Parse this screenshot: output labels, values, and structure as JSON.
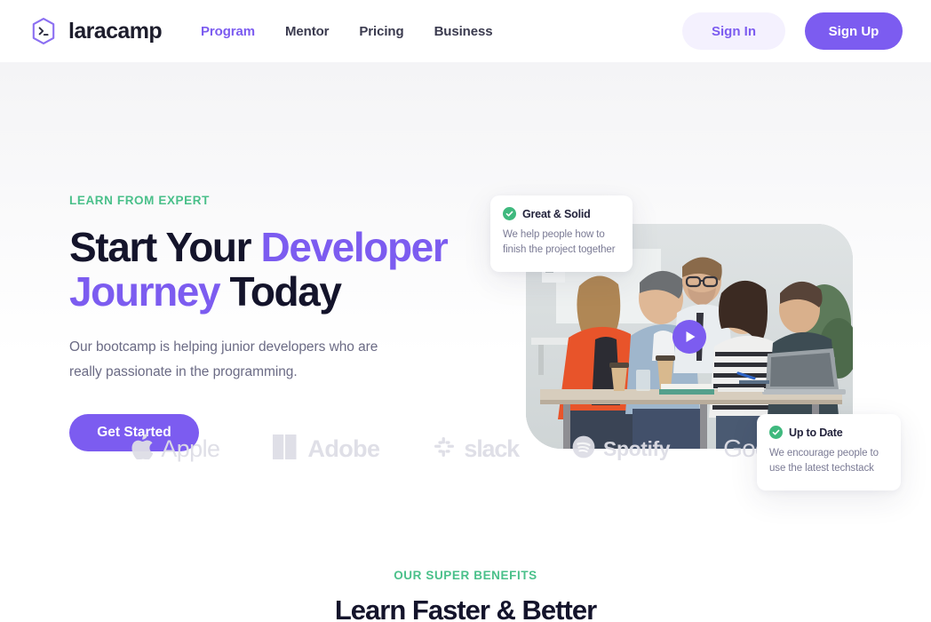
{
  "header": {
    "logo": {
      "icon": "hexagon-terminal-icon",
      "name": "laracamp"
    },
    "nav": [
      {
        "label": "Program",
        "active": true
      },
      {
        "label": "Mentor",
        "active": false
      },
      {
        "label": "Pricing",
        "active": false
      },
      {
        "label": "Business",
        "active": false
      }
    ],
    "sign_in": "Sign In",
    "sign_up": "Sign Up"
  },
  "hero": {
    "eyebrow": "LEARN FROM EXPERT",
    "title_line1_a": "Start Your ",
    "title_line1_b": "Developer",
    "title_line2_a": "Journey",
    "title_line2_b": " Today",
    "subtitle": "Our bootcamp is helping junior developers who are really passionate in the programming.",
    "cta": "Get Started",
    "play_button": "play-icon",
    "cards": [
      {
        "icon": "check-circle-icon",
        "title": "Great & Solid",
        "body": "We help people how to\nfinish the project together"
      },
      {
        "icon": "check-circle-icon",
        "title": "Up to Date",
        "body": "We encourage people to\nuse the latest techstack"
      }
    ]
  },
  "brands": [
    {
      "icon": "apple-icon",
      "label": "Apple"
    },
    {
      "icon": "adobe-icon",
      "label": "Adobe"
    },
    {
      "icon": "slack-icon",
      "label": "slack"
    },
    {
      "icon": "spotify-icon",
      "label": "Spotify"
    },
    {
      "icon": "google-icon",
      "label": "Google"
    }
  ],
  "benefits": {
    "eyebrow": "OUR SUPER BENEFITS",
    "title": "Learn Faster & Better"
  },
  "colors": {
    "accent_purple": "#7c5cf0",
    "accent_green": "#4ac08a",
    "text_dark": "#14142b",
    "text_muted": "#6b6b85",
    "brand_gray": "#dedee6"
  }
}
